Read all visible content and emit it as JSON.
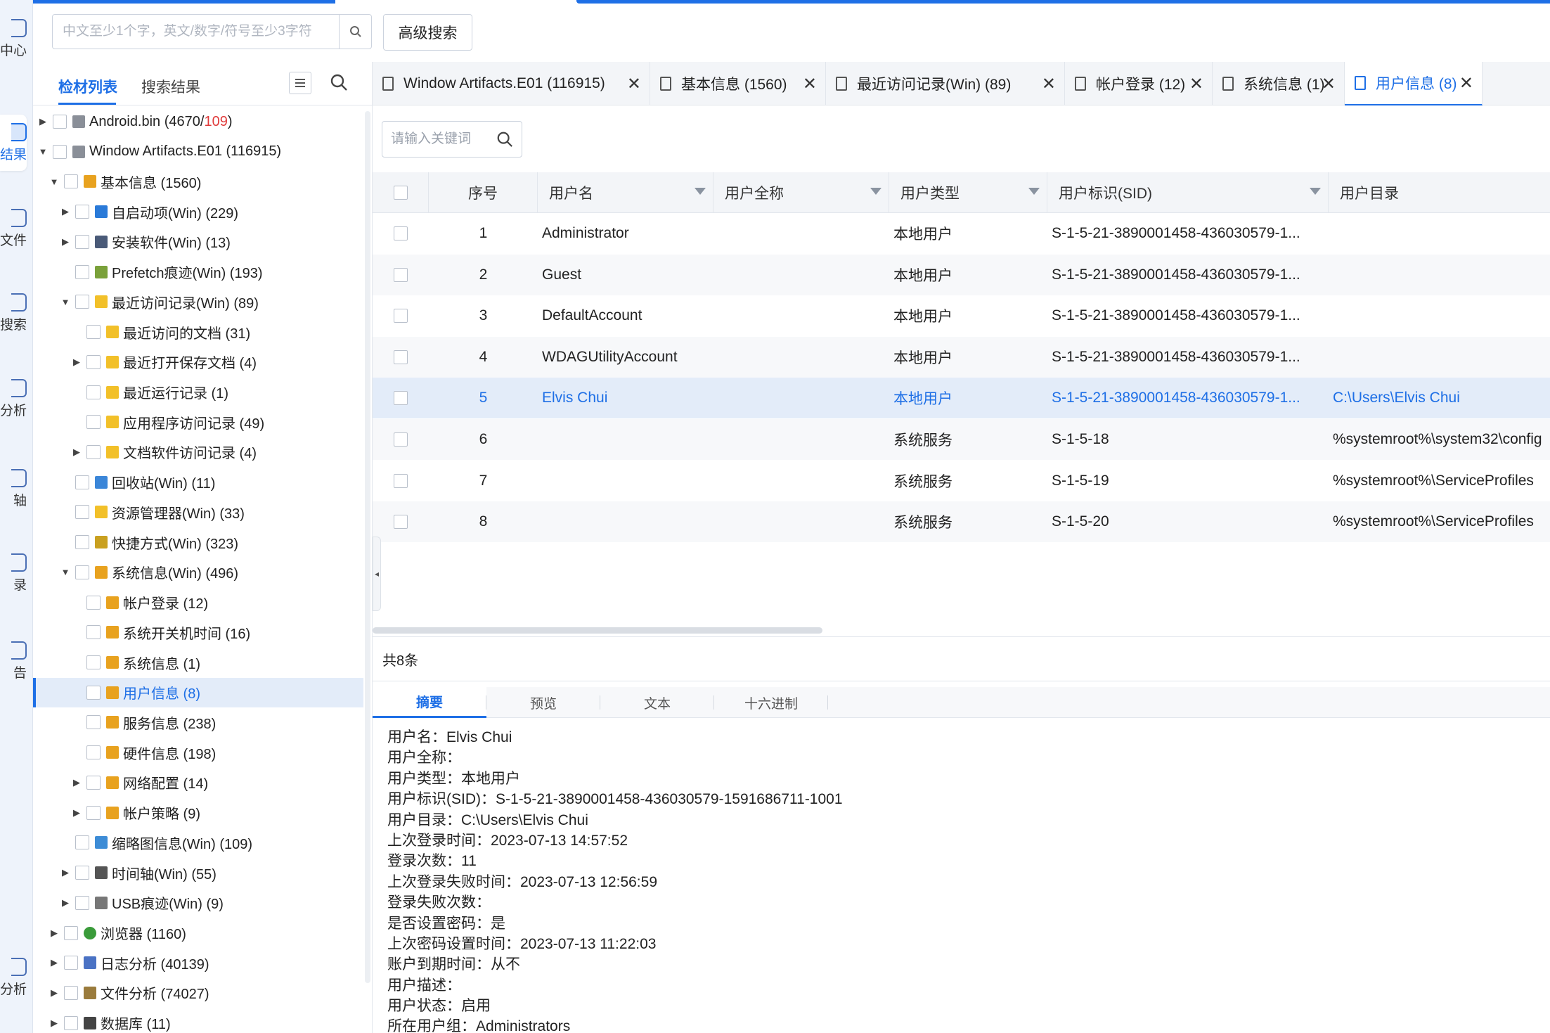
{
  "rail": [
    {
      "label": "中心",
      "icon": "home-icon"
    },
    {
      "label": "结果",
      "icon": "result-icon",
      "active": true
    },
    {
      "label": "文件",
      "icon": "file-icon"
    },
    {
      "label": "搜索",
      "icon": "search-icon"
    },
    {
      "label": "分析",
      "icon": "analysis-icon"
    },
    {
      "label": "轴",
      "icon": "timeline-icon"
    },
    {
      "label": "录",
      "icon": "record-icon"
    },
    {
      "label": "告",
      "icon": "report-icon"
    },
    {
      "label": "分析",
      "icon": "smart-analysis-icon"
    }
  ],
  "search": {
    "placeholder": "中文至少1个字，英文/数字/符号至少3字符",
    "advanced": "高级搜索"
  },
  "left_tabs": {
    "materials": "检材列表",
    "results": "搜索结果"
  },
  "tree": [
    {
      "label": "Android.bin (4670/",
      "red": "109",
      "tail": ")",
      "level": 0,
      "arrow": "right",
      "icon": "disk-icon"
    },
    {
      "label": "Window Artifacts.E01 (116915)",
      "level": 0,
      "arrow": "down",
      "icon": "disk-icon"
    },
    {
      "label": "基本信息 (1560)",
      "level": 1,
      "arrow": "down",
      "icon": "windows-icon"
    },
    {
      "label": "自启动项(Win) (229)",
      "level": 2,
      "arrow": "right",
      "icon": "startup-icon"
    },
    {
      "label": "安装软件(Win) (13)",
      "level": 2,
      "arrow": "right",
      "icon": "monitor-icon"
    },
    {
      "label": "Prefetch痕迹(Win) (193)",
      "level": 2,
      "arrow": "",
      "icon": "prefetch-icon"
    },
    {
      "label": "最近访问记录(Win) (89)",
      "level": 2,
      "arrow": "down",
      "icon": "folder-icon"
    },
    {
      "label": "最近访问的文档 (31)",
      "level": 3,
      "arrow": "",
      "icon": "folder-icon"
    },
    {
      "label": "最近打开保存文档 (4)",
      "level": 3,
      "arrow": "right",
      "icon": "folder-icon"
    },
    {
      "label": "最近运行记录 (1)",
      "level": 3,
      "arrow": "",
      "icon": "folder-icon"
    },
    {
      "label": "应用程序访问记录 (49)",
      "level": 3,
      "arrow": "",
      "icon": "folder-icon"
    },
    {
      "label": "文档软件访问记录 (4)",
      "level": 3,
      "arrow": "right",
      "icon": "folder-icon"
    },
    {
      "label": "回收站(Win) (11)",
      "level": 2,
      "arrow": "",
      "icon": "recycle-icon"
    },
    {
      "label": "资源管理器(Win) (33)",
      "level": 2,
      "arrow": "",
      "icon": "folder-icon"
    },
    {
      "label": "快捷方式(Win) (323)",
      "level": 2,
      "arrow": "",
      "icon": "shortcut-icon"
    },
    {
      "label": "系统信息(Win) (496)",
      "level": 2,
      "arrow": "down",
      "icon": "windows-icon"
    },
    {
      "label": "帐户登录 (12)",
      "level": 3,
      "arrow": "",
      "icon": "windows-icon"
    },
    {
      "label": "系统开关机时间 (16)",
      "level": 3,
      "arrow": "",
      "icon": "windows-icon"
    },
    {
      "label": "系统信息 (1)",
      "level": 3,
      "arrow": "",
      "icon": "windows-icon"
    },
    {
      "label": "用户信息 (8)",
      "level": 3,
      "arrow": "",
      "icon": "windows-icon",
      "selected": true
    },
    {
      "label": "服务信息 (238)",
      "level": 3,
      "arrow": "",
      "icon": "windows-icon"
    },
    {
      "label": "硬件信息 (198)",
      "level": 3,
      "arrow": "",
      "icon": "windows-icon"
    },
    {
      "label": "网络配置 (14)",
      "level": 3,
      "arrow": "right",
      "icon": "windows-icon"
    },
    {
      "label": "帐户策略 (9)",
      "level": 3,
      "arrow": "right",
      "icon": "windows-icon"
    },
    {
      "label": "缩略图信息(Win) (109)",
      "level": 2,
      "arrow": "",
      "icon": "thumbnail-icon"
    },
    {
      "label": "时间轴(Win) (55)",
      "level": 2,
      "arrow": "right",
      "icon": "timeline-icon"
    },
    {
      "label": "USB痕迹(Win) (9)",
      "level": 2,
      "arrow": "right",
      "icon": "usb-icon"
    },
    {
      "label": "浏览器 (1160)",
      "level": 1,
      "arrow": "right",
      "icon": "browser-icon"
    },
    {
      "label": "日志分析 (40139)",
      "level": 1,
      "arrow": "right",
      "icon": "log-icon"
    },
    {
      "label": "文件分析 (74027)",
      "level": 1,
      "arrow": "right",
      "icon": "file-analysis-icon"
    },
    {
      "label": "数据库 (11)",
      "level": 1,
      "arrow": "right",
      "icon": "database-icon"
    }
  ],
  "tabs": [
    {
      "label": "Window Artifacts.E01 (116915)"
    },
    {
      "label": "基本信息 (1560)"
    },
    {
      "label": "最近访问记录(Win) (89)"
    },
    {
      "label": "帐户登录 (12)"
    },
    {
      "label": "系统信息 (1)"
    },
    {
      "label": "用户信息 (8)",
      "active": true
    }
  ],
  "keyword": {
    "placeholder": "请输入关键词"
  },
  "columns": [
    "序号",
    "用户名",
    "用户全称",
    "用户类型",
    "用户标识(SID)",
    "用户目录"
  ],
  "rows": [
    {
      "no": "1",
      "name": "Administrator",
      "full": "",
      "type": "本地用户",
      "sid": "S-1-5-21-3890001458-436030579-1...",
      "dir": ""
    },
    {
      "no": "2",
      "name": "Guest",
      "full": "",
      "type": "本地用户",
      "sid": "S-1-5-21-3890001458-436030579-1...",
      "dir": ""
    },
    {
      "no": "3",
      "name": "DefaultAccount",
      "full": "",
      "type": "本地用户",
      "sid": "S-1-5-21-3890001458-436030579-1...",
      "dir": ""
    },
    {
      "no": "4",
      "name": "WDAGUtilityAccount",
      "full": "",
      "type": "本地用户",
      "sid": "S-1-5-21-3890001458-436030579-1...",
      "dir": ""
    },
    {
      "no": "5",
      "name": "Elvis Chui",
      "full": "",
      "type": "本地用户",
      "sid": "S-1-5-21-3890001458-436030579-1...",
      "dir": "C:\\Users\\Elvis Chui",
      "selected": true
    },
    {
      "no": "6",
      "name": "",
      "full": "",
      "type": "系统服务",
      "sid": "S-1-5-18",
      "dir": "%systemroot%\\system32\\config"
    },
    {
      "no": "7",
      "name": "",
      "full": "",
      "type": "系统服务",
      "sid": "S-1-5-19",
      "dir": "%systemroot%\\ServiceProfiles"
    },
    {
      "no": "8",
      "name": "",
      "full": "",
      "type": "系统服务",
      "sid": "S-1-5-20",
      "dir": "%systemroot%\\ServiceProfiles"
    }
  ],
  "count": "共8条",
  "detail_tabs": [
    "摘要",
    "预览",
    "文本",
    "十六进制"
  ],
  "detail": [
    "用户名：Elvis Chui",
    "用户全称：",
    "用户类型：本地用户",
    "用户标识(SID)：S-1-5-21-3890001458-436030579-1591686711-1001",
    "用户目录：C:\\Users\\Elvis Chui",
    "上次登录时间：2023-07-13 14:57:52",
    "登录次数：11",
    "上次登录失败时间：2023-07-13 12:56:59",
    "登录失败次数：",
    "是否设置密码：是",
    "上次密码设置时间：2023-07-13 11:22:03",
    "账户到期时间：从不",
    "用户描述：",
    "用户状态：启用",
    "所在用户组：Administrators"
  ],
  "colors": {
    "accent": "#1e6fe6",
    "selected_bg": "#e3ecf9",
    "red": "#e03a3a"
  }
}
